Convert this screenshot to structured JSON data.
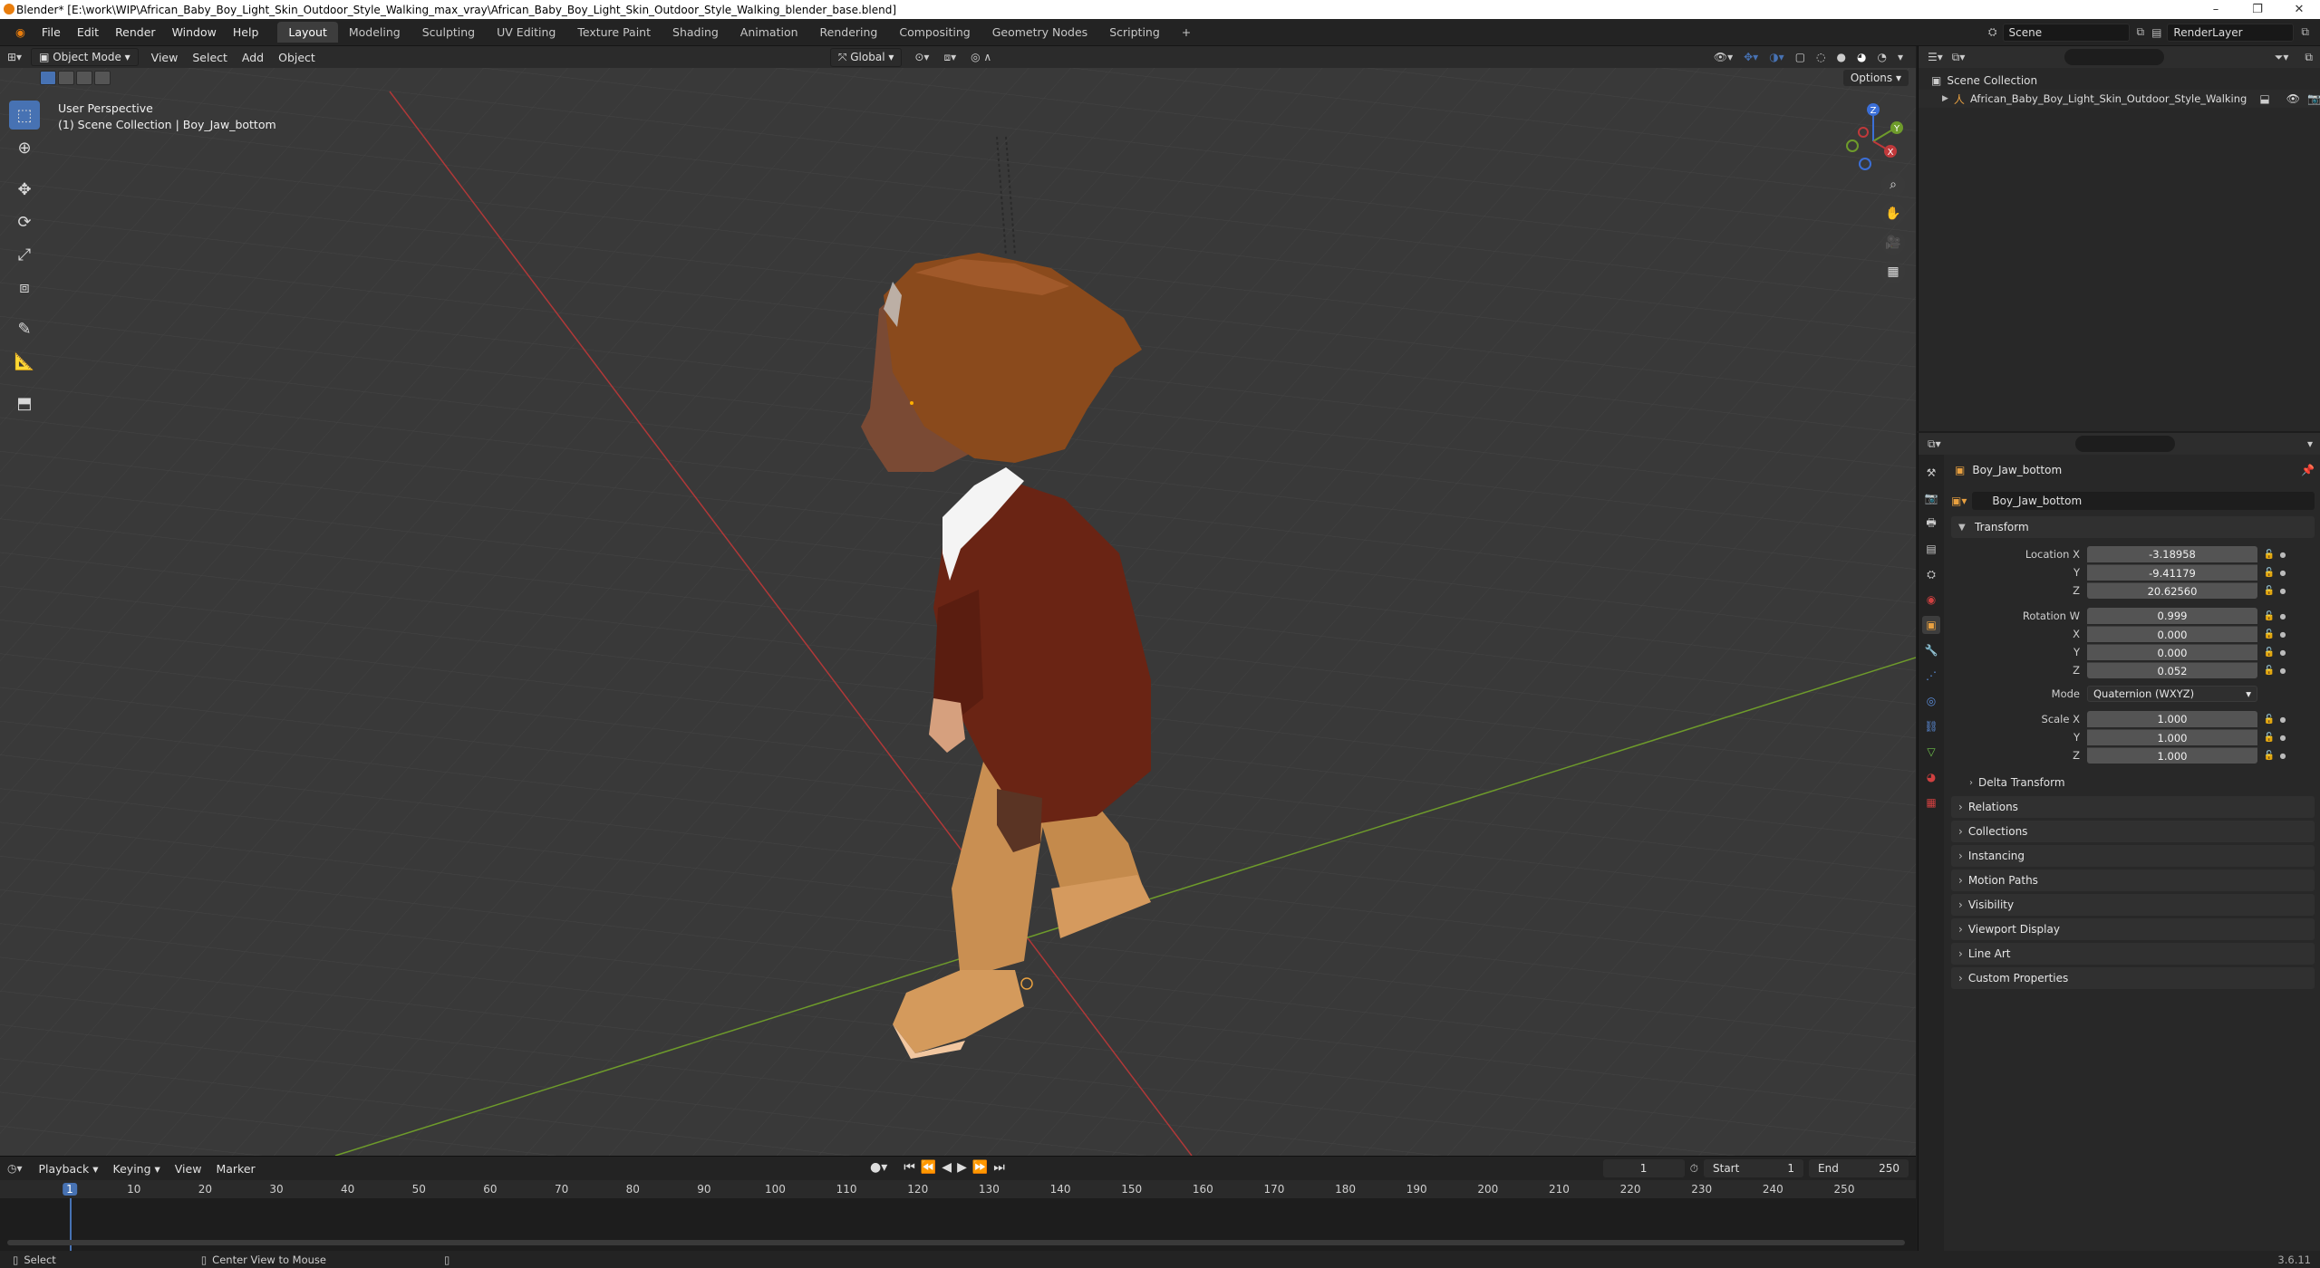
{
  "window": {
    "title": "Blender* [E:\\work\\WIP\\African_Baby_Boy_Light_Skin_Outdoor_Style_Walking_max_vray\\African_Baby_Boy_Light_Skin_Outdoor_Style_Walking_blender_base.blend]",
    "minimize": "–",
    "maximize": "❐",
    "close": "✕"
  },
  "menu": [
    "File",
    "Edit",
    "Render",
    "Window",
    "Help"
  ],
  "workspaces": [
    {
      "label": "Layout",
      "active": true
    },
    {
      "label": "Modeling",
      "active": false
    },
    {
      "label": "Sculpting",
      "active": false
    },
    {
      "label": "UV Editing",
      "active": false
    },
    {
      "label": "Texture Paint",
      "active": false
    },
    {
      "label": "Shading",
      "active": false
    },
    {
      "label": "Animation",
      "active": false
    },
    {
      "label": "Rendering",
      "active": false
    },
    {
      "label": "Compositing",
      "active": false
    },
    {
      "label": "Geometry Nodes",
      "active": false
    },
    {
      "label": "Scripting",
      "active": false
    }
  ],
  "add_workspace": "+",
  "scene_name": "Scene",
  "render_layer": "RenderLayer",
  "viewport": {
    "mode": "Object Mode",
    "menus": [
      "View",
      "Select",
      "Add",
      "Object"
    ],
    "orientation": "Global",
    "options": "Options",
    "perspective": "User Perspective",
    "collection_info": "(1) Scene Collection | Boy_Jaw_bottom",
    "gizmo": {
      "x": "X",
      "y": "Y",
      "z": "Z"
    }
  },
  "timeline": {
    "menus": [
      "Playback",
      "Keying",
      "View",
      "Marker"
    ],
    "current_frame": "1",
    "start_label": "Start",
    "start": "1",
    "end_label": "End",
    "end": "250",
    "ruler": [
      "1",
      "10",
      "20",
      "30",
      "40",
      "50",
      "60",
      "70",
      "80",
      "90",
      "100",
      "110",
      "120",
      "130",
      "140",
      "150",
      "160",
      "170",
      "180",
      "190",
      "200",
      "210",
      "220",
      "230",
      "240",
      "250"
    ]
  },
  "status": {
    "select": "Select",
    "center_view": "Center View to Mouse",
    "version": "3.6.11"
  },
  "outliner": {
    "root": "Scene Collection",
    "items": [
      "African_Baby_Boy_Light_Skin_Outdoor_Style_Walking"
    ]
  },
  "properties": {
    "object_name": "Boy_Jaw_bottom",
    "datablock": "Boy_Jaw_bottom",
    "transform": {
      "title": "Transform",
      "location_label": "Location X",
      "location": {
        "x": "-3.18958",
        "y": "-9.41179",
        "z": "20.62560"
      },
      "rotation_label": "Rotation W",
      "rotation": {
        "w": "0.999",
        "x": "0.000",
        "y": "0.000",
        "z": "0.052"
      },
      "mode_label": "Mode",
      "mode": "Quaternion (WXYZ)",
      "scale_label": "Scale X",
      "scale": {
        "x": "1.000",
        "y": "1.000",
        "z": "1.000"
      },
      "axis_y": "Y",
      "axis_z": "Z",
      "axis_x": "X",
      "delta": "Delta Transform"
    },
    "panels": [
      "Relations",
      "Collections",
      "Instancing",
      "Motion Paths",
      "Visibility",
      "Viewport Display",
      "Line Art",
      "Custom Properties"
    ]
  },
  "colors": {
    "accent": "#4772b3",
    "viewport_bg": "#393939",
    "x_axis": "#c0393b",
    "y_axis": "#6e9b2b",
    "hat": "#8a4a1c",
    "jacket": "#6a2414",
    "pants": "#c98f52",
    "skin": "#7a4a34"
  }
}
